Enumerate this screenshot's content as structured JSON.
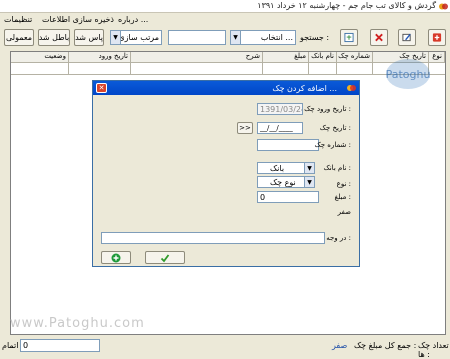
{
  "window": {
    "title": "گردش و کالای تب جام جم - چهارشنبه ۱۲ خرداد ۱۳۹۱"
  },
  "menu": {
    "items": [
      "تنظیمات",
      "ذخیره سازی اطلاعات",
      "درباره ..."
    ]
  },
  "toolbar": {
    "search_label": "جستجو :",
    "search_placeholder": "انتخاب ...",
    "sort_label": "مرتب سازی",
    "sort_value": "",
    "paid_button": "پاس شد",
    "cancelled_button": "باطل شد",
    "normal_button": "معمولی"
  },
  "grid": {
    "columns": [
      "نوع",
      "تاریخ چک",
      "شماره چک",
      "نام بانک",
      "مبلغ",
      "شرح",
      "تاریخ ورود",
      "وضعیت"
    ]
  },
  "watermark": {
    "text": "www.Patoghu.com",
    "logo_text": "Patoghu"
  },
  "status": {
    "count_label": "تعداد چک ها :",
    "count_value": "",
    "total_label": "جمع کل مبلغ چک :",
    "total_value": "صفر",
    "right_label": "اتمام",
    "input_value": "0"
  },
  "dialog": {
    "title": "اضافه کردن چک ...",
    "entry_date_label": "تاریخ ورود چک :",
    "entry_date_value": "1391/03/24",
    "check_date_label": "تاریخ چک :",
    "check_date_value": "__/__/____",
    "picker_button": ">>",
    "check_number_label": "شماره چک :",
    "check_number_value": "",
    "bank_label": "نام بانک :",
    "bank_value": "بانک",
    "type_label": "نوع :",
    "type_value": "نوع چک",
    "amount_label": "مبلغ :",
    "amount_value": "0",
    "zero_label": "صفر",
    "description_label": "در وجه :",
    "description_value": ""
  }
}
